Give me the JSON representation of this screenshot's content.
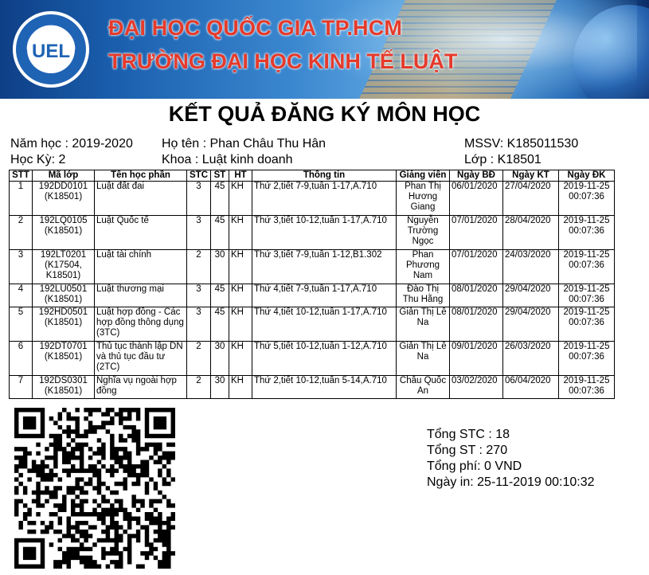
{
  "header": {
    "logo_text": "UEL",
    "logo_ring_text": "TRƯỜNG ĐẠI HỌC KINH TẾ - LUẬT · UNIVERSITY OF ECONOMICS AND LAW",
    "university_line1": "ĐẠI HỌC QUỐC GIA TP.HCM",
    "university_line2": "TRƯỜNG ĐẠI HỌC KINH TẾ LUẬT",
    "accent_color": "#e53a2b"
  },
  "title": "KẾT QUẢ ĐĂNG KÝ MÔN HỌC",
  "student": {
    "school_year": "Năm học : 2019-2020",
    "semester": "Học Kỳ: 2",
    "full_name": "Họ tên : Phan Châu Thu  Hân",
    "faculty": "Khoa : Luật kinh doanh",
    "student_id": "MSSV: K185011530",
    "class": "Lớp  : K18501"
  },
  "table": {
    "headers": [
      "STT",
      "Mã lớp",
      "Tên học phần",
      "STC",
      "ST",
      "HT",
      "Thông tin",
      "Giảng viên",
      "Ngày BĐ",
      "Ngày KT",
      "Ngày ĐK"
    ],
    "rows": [
      [
        "1",
        "192DD0101 (K18501)",
        "Luật đất đai",
        "3",
        "45",
        "KH",
        "Thứ 2,tiết 7-9,tuần 1-17,A.710",
        "Phan Thị Hương Giang",
        "06/01/2020",
        "27/04/2020",
        "2019-11-25 00:07:36"
      ],
      [
        "2",
        "192LQ0105 (K18501)",
        "Luật Quốc tế",
        "3",
        "45",
        "KH",
        "Thứ 3,tiết 10-12,tuần 1-17,A.710",
        "Nguyễn Trường Ngọc",
        "07/01/2020",
        "28/04/2020",
        "2019-11-25 00:07:36"
      ],
      [
        "3",
        "192LT0201 (K17504, K18501)",
        "Luật tài chính",
        "2",
        "30",
        "KH",
        "Thứ 3,tiết 7-9,tuần 1-12,B1.302",
        "Phan Phương Nam",
        "07/01/2020",
        "24/03/2020",
        "2019-11-25 00:07:36"
      ],
      [
        "4",
        "192LU0501 (K18501)",
        "Luật thương mại",
        "3",
        "45",
        "KH",
        "Thứ 4,tiết 7-9,tuần 1-17,A.710",
        "Đào Thị Thu Hằng",
        "08/01/2020",
        "29/04/2020",
        "2019-11-25 00:07:36"
      ],
      [
        "5",
        "192HD0501 (K18501)",
        "Luật hợp đồng - Các hợp đồng thông dụng (3TC)",
        "3",
        "45",
        "KH",
        "Thứ 4,tiết 10-12,tuần 1-17,A.710",
        "Giản Thị Lê Na",
        "08/01/2020",
        "29/04/2020",
        "2019-11-25 00:07:36"
      ],
      [
        "6",
        "192DT0701 (K18501)",
        "Thủ tục thành lập DN và thủ tục đầu tư (2TC)",
        "2",
        "30",
        "KH",
        "Thứ 5,tiết 10-12,tuần 1-12,A.710",
        "Giản Thị Lê Na",
        "09/01/2020",
        "26/03/2020",
        "2019-11-25 00:07:36"
      ],
      [
        "7",
        "192DS0301 (K18501)",
        "Nghĩa vụ ngoài hợp đồng",
        "2",
        "30",
        "KH",
        "Thứ 2,tiết 10-12,tuần 5-14,A.710",
        "Châu Quốc An",
        "03/02/2020",
        "06/04/2020",
        "2019-11-25 00:07:36"
      ]
    ]
  },
  "summary": {
    "total_credits": "Tổng STC : 18",
    "total_periods": "Tổng ST : 270",
    "total_fee": "Tổng phí: 0 VND",
    "print_date": "Ngày in: 25-11-2019 00:10:32"
  }
}
